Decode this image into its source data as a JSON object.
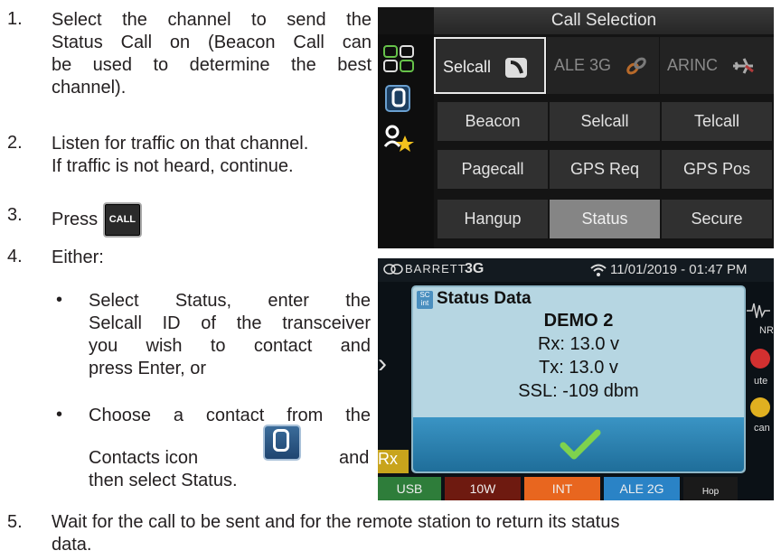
{
  "steps": [
    {
      "num": "1.",
      "lines": [
        "Select the channel to send the",
        "Status Call on (Beacon Call can",
        "be used to determine the best",
        "channel)."
      ]
    },
    {
      "num": "2.",
      "lines": [
        "Listen for traffic on that channel.",
        "If traffic is not heard, continue."
      ]
    },
    {
      "num": "3.",
      "press": "Press",
      "key": "CALL"
    },
    {
      "num": "4.",
      "label": "Either:"
    },
    {
      "num": "5.",
      "lines": [
        "Wait for the call to be sent and for the remote station to return its status",
        "data."
      ]
    }
  ],
  "bullets": [
    {
      "lines": [
        "Select Status, enter the",
        "Selcall ID of the transceiver",
        "you wish to contact and",
        "press Enter, or"
      ]
    },
    {
      "line1": "Choose a contact from the",
      "line2a": "Contacts icon",
      "line2b": "and",
      "line3": "then select Status."
    }
  ],
  "screen1": {
    "title": "Call Selection",
    "tabs": [
      "Selcall",
      "ALE 3G",
      "ARINC"
    ],
    "grid": [
      [
        "Beacon",
        "Selcall",
        "Telcall"
      ],
      [
        "Pagecall",
        "GPS Req",
        "GPS Pos"
      ],
      [
        "Hangup",
        "Status",
        "Secure"
      ]
    ],
    "selected": "Status",
    "icons": [
      "call-type-icon",
      "contacts-icon",
      "favorite-contacts-icon"
    ]
  },
  "screen2": {
    "brand": "BARRETT",
    "mode": "3G",
    "datetime": "11/01/2019 - 01:47 PM",
    "dialog_badge_top": "SC",
    "dialog_badge_bottom": "int",
    "dialog_title": "Status Data",
    "data": [
      "DEMO 2",
      "Rx: 13.0 v",
      "Tx: 13.0 v",
      "SSL: -109 dbm"
    ],
    "side_labels": [
      "NR",
      "ute",
      "can"
    ],
    "rx": "Rx",
    "statusbar": [
      "USB",
      "10W",
      "INT",
      "ALE 2G",
      "Hop"
    ],
    "colors": {
      "usb": "#2e7d3a",
      "10w": "#8a1f12",
      "int": "#e8661f",
      "ale": "#2a83c6",
      "hop": "#1a1a1a"
    }
  }
}
